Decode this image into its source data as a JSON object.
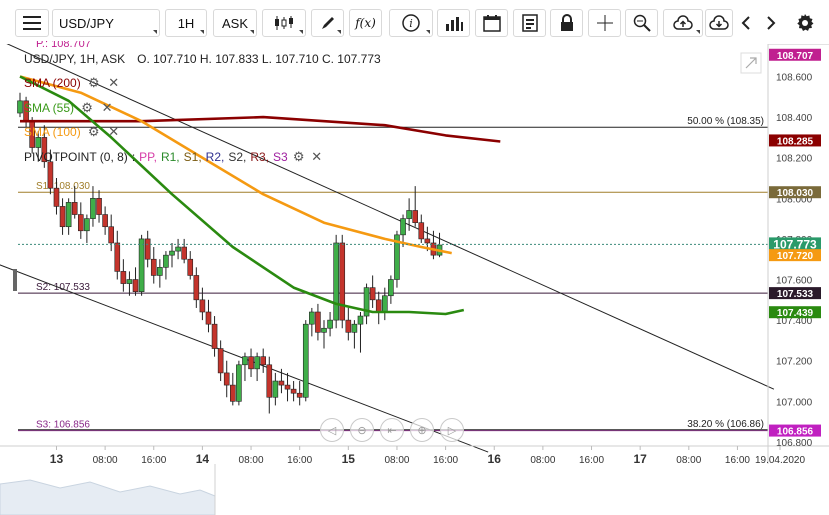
{
  "toolbar": {
    "symbol": "USD/JPY",
    "timeframe": "1H",
    "price_type": "ASK"
  },
  "legend": {
    "header": "USD/JPY, 1H, ASK",
    "ohlc": "O. 107.710 H. 107.833 L. 107.710 C. 107.773",
    "top_clipped": "P.: 108.707",
    "indicators": [
      {
        "label": "SMA (200)",
        "color": "#8b0000"
      },
      {
        "label": "SMA (55)",
        "color": "#3a9a1a"
      },
      {
        "label": "SMA (100)",
        "color": "#f59a12"
      }
    ],
    "pivot_label": "PIVOTPOINT (0, 8)",
    "pivot_parts": [
      {
        "text": "PP,",
        "color": "#d63aa6"
      },
      {
        "text": "R1,",
        "color": "#2a8a2a"
      },
      {
        "text": "S1,",
        "color": "#7a5a10"
      },
      {
        "text": "R2,",
        "color": "#303090"
      },
      {
        "text": "S2,",
        "color": "#333333"
      },
      {
        "text": "R3,",
        "color": "#8a1a1a"
      },
      {
        "text": "S3",
        "color": "#a020a0"
      }
    ]
  },
  "chart_data": {
    "type": "candlestick",
    "symbol": "USD/JPY",
    "timeframe": "1H",
    "ylim": [
      106.78,
      108.76
    ],
    "y_ticks": [
      108.6,
      108.4,
      108.2,
      108.0,
      107.8,
      107.6,
      107.4,
      107.2,
      107.0,
      106.8
    ],
    "y_tick_labels": [
      "108.600",
      "108.400",
      "108.200",
      "108.000",
      "107.800",
      "107.600",
      "107.400",
      "107.200",
      "107.000",
      "106.800"
    ],
    "x_tick_labels": [
      {
        "label": "13",
        "bold": true,
        "index": 6
      },
      {
        "label": "08:00",
        "bold": false,
        "index": 14
      },
      {
        "label": "16:00",
        "bold": false,
        "index": 22
      },
      {
        "label": "14",
        "bold": true,
        "index": 30
      },
      {
        "label": "08:00",
        "bold": false,
        "index": 38
      },
      {
        "label": "16:00",
        "bold": false,
        "index": 46
      },
      {
        "label": "15",
        "bold": true,
        "index": 54
      },
      {
        "label": "08:00",
        "bold": false,
        "index": 62
      },
      {
        "label": "16:00",
        "bold": false,
        "index": 70
      },
      {
        "label": "16",
        "bold": true,
        "index": 78
      },
      {
        "label": "08:00",
        "bold": false,
        "index": 86
      },
      {
        "label": "16:00",
        "bold": false,
        "index": 94
      },
      {
        "label": "17",
        "bold": true,
        "index": 102
      },
      {
        "label": "08:00",
        "bold": false,
        "index": 110
      },
      {
        "label": "16:00",
        "bold": false,
        "index": 118
      },
      {
        "label": "19.04.2020",
        "bold": false,
        "index": 125
      }
    ],
    "candles": [
      [
        108.42,
        108.52,
        108.4,
        108.48
      ],
      [
        108.48,
        108.5,
        108.35,
        108.38
      ],
      [
        108.38,
        108.4,
        108.22,
        108.25
      ],
      [
        108.25,
        108.33,
        108.18,
        108.3
      ],
      [
        108.3,
        108.36,
        108.15,
        108.18
      ],
      [
        108.18,
        108.24,
        108.02,
        108.05
      ],
      [
        108.05,
        108.1,
        107.92,
        107.96
      ],
      [
        107.96,
        108.0,
        107.82,
        107.86
      ],
      [
        107.86,
        108.0,
        107.82,
        107.98
      ],
      [
        107.98,
        108.06,
        107.9,
        107.92
      ],
      [
        107.92,
        107.98,
        107.8,
        107.84
      ],
      [
        107.84,
        107.92,
        107.78,
        107.9
      ],
      [
        107.9,
        108.06,
        107.86,
        108.0
      ],
      [
        108.0,
        108.04,
        107.88,
        107.92
      ],
      [
        107.92,
        107.96,
        107.82,
        107.86
      ],
      [
        107.86,
        107.92,
        107.74,
        107.78
      ],
      [
        107.78,
        107.84,
        107.6,
        107.64
      ],
      [
        107.64,
        107.7,
        107.54,
        107.58
      ],
      [
        107.58,
        107.64,
        107.52,
        107.6
      ],
      [
        107.6,
        107.66,
        107.52,
        107.54
      ],
      [
        107.54,
        107.82,
        107.52,
        107.8
      ],
      [
        107.8,
        107.84,
        107.66,
        107.7
      ],
      [
        107.7,
        107.76,
        107.58,
        107.62
      ],
      [
        107.62,
        107.7,
        107.56,
        107.66
      ],
      [
        107.66,
        107.74,
        107.6,
        107.72
      ],
      [
        107.72,
        107.78,
        107.66,
        107.74
      ],
      [
        107.74,
        107.8,
        107.7,
        107.76
      ],
      [
        107.76,
        107.8,
        107.68,
        107.7
      ],
      [
        107.7,
        107.74,
        107.6,
        107.62
      ],
      [
        107.62,
        107.66,
        107.46,
        107.5
      ],
      [
        107.5,
        107.56,
        107.4,
        107.44
      ],
      [
        107.44,
        107.5,
        107.34,
        107.38
      ],
      [
        107.38,
        107.42,
        107.22,
        107.26
      ],
      [
        107.26,
        107.3,
        107.1,
        107.14
      ],
      [
        107.14,
        107.2,
        107.02,
        107.08
      ],
      [
        107.08,
        107.14,
        106.98,
        107.0
      ],
      [
        107.0,
        107.2,
        106.98,
        107.18
      ],
      [
        107.18,
        107.24,
        107.1,
        107.22
      ],
      [
        107.22,
        107.26,
        107.12,
        107.16
      ],
      [
        107.16,
        107.24,
        107.1,
        107.22
      ],
      [
        107.22,
        107.26,
        107.14,
        107.18
      ],
      [
        107.18,
        107.22,
        106.94,
        107.02
      ],
      [
        107.02,
        107.14,
        106.98,
        107.1
      ],
      [
        107.1,
        107.16,
        107.04,
        107.08
      ],
      [
        107.08,
        107.14,
        107.0,
        107.06
      ],
      [
        107.06,
        107.1,
        107.0,
        107.04
      ],
      [
        107.04,
        107.1,
        106.98,
        107.02
      ],
      [
        107.02,
        107.4,
        107.0,
        107.38
      ],
      [
        107.38,
        107.46,
        107.32,
        107.44
      ],
      [
        107.44,
        107.48,
        107.3,
        107.34
      ],
      [
        107.34,
        107.4,
        107.26,
        107.36
      ],
      [
        107.36,
        107.44,
        107.32,
        107.4
      ],
      [
        107.4,
        107.82,
        107.36,
        107.78
      ],
      [
        107.78,
        107.82,
        107.36,
        107.4
      ],
      [
        107.4,
        107.46,
        107.3,
        107.34
      ],
      [
        107.34,
        107.4,
        107.26,
        107.38
      ],
      [
        107.38,
        107.44,
        107.24,
        107.42
      ],
      [
        107.42,
        107.58,
        107.38,
        107.56
      ],
      [
        107.56,
        107.62,
        107.46,
        107.5
      ],
      [
        107.5,
        107.54,
        107.38,
        107.44
      ],
      [
        107.44,
        107.56,
        107.4,
        107.52
      ],
      [
        107.52,
        107.62,
        107.48,
        107.6
      ],
      [
        107.6,
        107.84,
        107.56,
        107.82
      ],
      [
        107.82,
        107.92,
        107.76,
        107.9
      ],
      [
        107.9,
        108.0,
        107.84,
        107.94
      ],
      [
        107.94,
        108.06,
        107.86,
        107.88
      ],
      [
        107.88,
        107.92,
        107.78,
        107.8
      ],
      [
        107.8,
        107.86,
        107.74,
        107.78
      ],
      [
        107.78,
        107.84,
        107.7,
        107.72
      ],
      [
        107.72,
        107.83,
        107.71,
        107.77
      ]
    ],
    "series": [
      {
        "name": "SMA (200)",
        "color": "#8b0000",
        "values": [
          [
            0,
            108.38
          ],
          [
            20,
            108.38
          ],
          [
            40,
            108.4
          ],
          [
            60,
            108.36
          ],
          [
            70,
            108.31
          ],
          [
            79,
            108.28
          ]
        ]
      },
      {
        "name": "SMA (100)",
        "color": "#f59a12",
        "values": [
          [
            0,
            108.6
          ],
          [
            10,
            108.52
          ],
          [
            20,
            108.38
          ],
          [
            30,
            108.2
          ],
          [
            40,
            108.02
          ],
          [
            50,
            107.88
          ],
          [
            60,
            107.8
          ],
          [
            66,
            107.76
          ],
          [
            71,
            107.73
          ]
        ]
      },
      {
        "name": "SMA (55)",
        "color": "#2a8a10",
        "values": [
          [
            0,
            108.6
          ],
          [
            8,
            108.48
          ],
          [
            15,
            108.3
          ],
          [
            25,
            108.02
          ],
          [
            35,
            107.76
          ],
          [
            45,
            107.56
          ],
          [
            52,
            107.48
          ],
          [
            58,
            107.44
          ],
          [
            64,
            107.44
          ],
          [
            70,
            107.43
          ],
          [
            73,
            107.45
          ]
        ]
      }
    ],
    "levels": [
      {
        "name": "50.00 % (108.35)",
        "value": 108.35,
        "color": "#222222",
        "label_side": "right"
      },
      {
        "name": "S1: 108.030",
        "value": 108.03,
        "color": "#a07e2a",
        "label_side": "left"
      },
      {
        "name": "S2: 107.533",
        "value": 107.533,
        "color": "#3a1a3a",
        "label_side": "left"
      },
      {
        "name": "S3: 106.856",
        "value": 106.856,
        "color": "#8a2a8a",
        "label_side": "left"
      },
      {
        "name": "38.20 % (106.86)",
        "value": 106.86,
        "color": "#222222",
        "label_side": "right"
      }
    ],
    "current_price": 107.773,
    "price_tags": [
      {
        "text": "108.707",
        "bg": "#c02090"
      },
      {
        "text": "108.285",
        "bg": "#8b0000"
      },
      {
        "text": "108.030",
        "bg": "#7a6a3a"
      },
      {
        "text": "107.773",
        "bg": "#2a9a6a"
      },
      {
        "text": "107.720",
        "bg": "#f59a12"
      },
      {
        "text": "107.533",
        "bg": "#2a1a2a"
      },
      {
        "text": "107.439",
        "bg": "#2a8a10"
      },
      {
        "text": "106.856",
        "bg": "#c020c0"
      }
    ],
    "tag_values": [
      108.707,
      108.285,
      108.03,
      107.773,
      107.72,
      107.533,
      107.439,
      106.856
    ],
    "trend_lines": [
      {
        "from": [
          -5,
          108.8
        ],
        "to": [
          124,
          107.06
        ],
        "color": "#222222"
      },
      {
        "from": [
          -4,
          107.68
        ],
        "to": [
          77,
          106.75
        ],
        "color": "#222222"
      }
    ]
  }
}
